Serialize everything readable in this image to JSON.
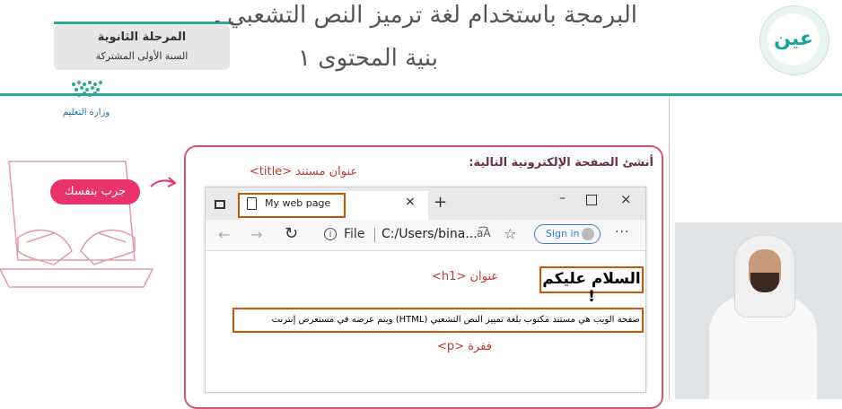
{
  "header": {
    "title_line1": "البرمجة باستخدام لغة ترميز النص التشعبي HTML",
    "title_line2": "بنية المحتوى ١",
    "stage": "المرحلة الثانوية",
    "year": "السنة الأولى المشتركة",
    "logo_text": "عين",
    "ministry": "وزارة التعليم"
  },
  "slide": {
    "try_button": "جرب بنفسك",
    "instruction": "أنشئ الصفحة الإلكترونية التالية:",
    "title_annotation": "عنوان مستند <title>",
    "h1_annotation": "عنوان <h1>",
    "p_annotation": "فقرة <p>"
  },
  "browser": {
    "tab_title": "My web page",
    "tab_close": "×",
    "new_tab": "+",
    "min": "–",
    "close": "×",
    "back": "←",
    "forward": "→",
    "reload": "↻",
    "info": "i",
    "file_label": "File",
    "url": "C:/Users/bina...",
    "read_icon": "a͡A",
    "fav_icon": "☆",
    "sign_in": "Sign in",
    "more": "···",
    "page_h1": "السلام عليكم !",
    "page_p": "صفحة الويب هي مستند مكتوب بلغة تمييز النص التشعبي (HTML) ويتم عرضه في مستعرض إنترنت"
  },
  "colors": {
    "accent": "#2aa89a",
    "frame": "#d8546e",
    "highlight": "#d35400",
    "button": "#e8346a"
  }
}
